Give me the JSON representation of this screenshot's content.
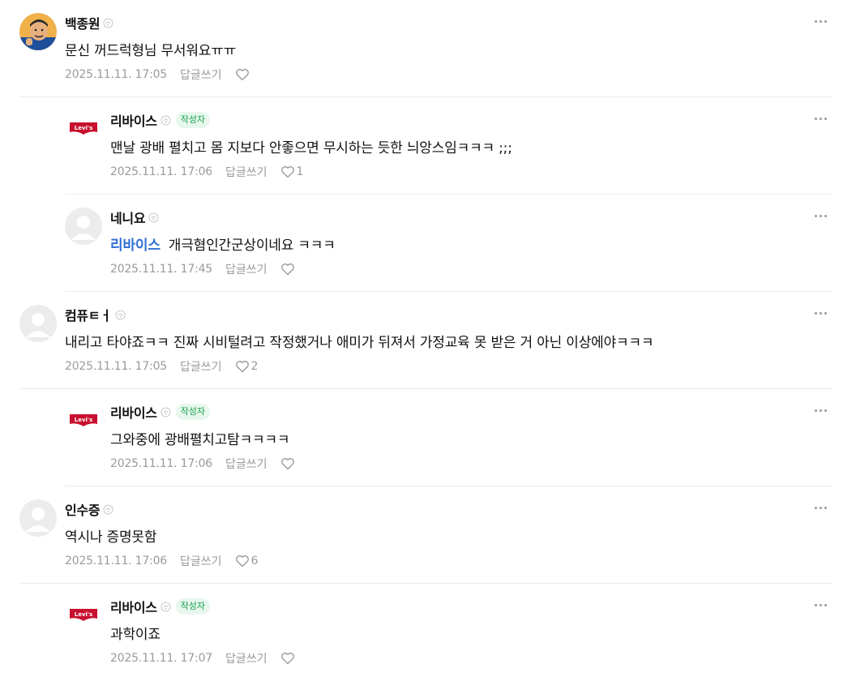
{
  "ui": {
    "reply_label": "답글쓰기",
    "author_badge": "작성자",
    "accent_mention": "#2f6fd6",
    "accent_author": "#16a34a"
  },
  "comments": [
    {
      "nick": "백종원",
      "avatar": "photo-avatar",
      "is_author": false,
      "mention": "",
      "text": "문신 꺼드럭형님 무서워요ㅠㅠ",
      "date": "2025.11.11. 17:05",
      "likes": ""
    },
    {
      "nick": "리바이스",
      "avatar": "levis-logo",
      "is_author": true,
      "mention": "",
      "text": "맨날 광배 펼치고 몸 지보다 안좋으면 무시하는 듯한 늬앙스임ㅋㅋㅋ ;;;",
      "date": "2025.11.11. 17:06",
      "likes": "1"
    },
    {
      "nick": "네니요",
      "avatar": "default-avatar",
      "is_author": false,
      "mention": "리바이스",
      "text": "개극혐인간군상이네요 ㅋㅋㅋ",
      "date": "2025.11.11. 17:45",
      "likes": ""
    },
    {
      "nick": "컴퓨ㅌㅓ",
      "avatar": "default-avatar",
      "is_author": false,
      "mention": "",
      "text": "내리고 타야죠ㅋㅋ 진짜 시비털려고 작정했거나 애미가 뒤져서 가정교육 못 받은 거 아닌 이상에야ㅋㅋㅋ",
      "date": "2025.11.11. 17:05",
      "likes": "2"
    },
    {
      "nick": "리바이스",
      "avatar": "levis-logo",
      "is_author": true,
      "mention": "",
      "text": "그와중에 광배펼치고탐ㅋㅋㅋㅋ",
      "date": "2025.11.11. 17:06",
      "likes": ""
    },
    {
      "nick": "인수증",
      "avatar": "default-avatar",
      "is_author": false,
      "mention": "",
      "text": "역시나 증명못함",
      "date": "2025.11.11. 17:06",
      "likes": "6"
    },
    {
      "nick": "리바이스",
      "avatar": "levis-logo",
      "is_author": true,
      "mention": "",
      "text": "과학이죠",
      "date": "2025.11.11. 17:07",
      "likes": ""
    }
  ]
}
